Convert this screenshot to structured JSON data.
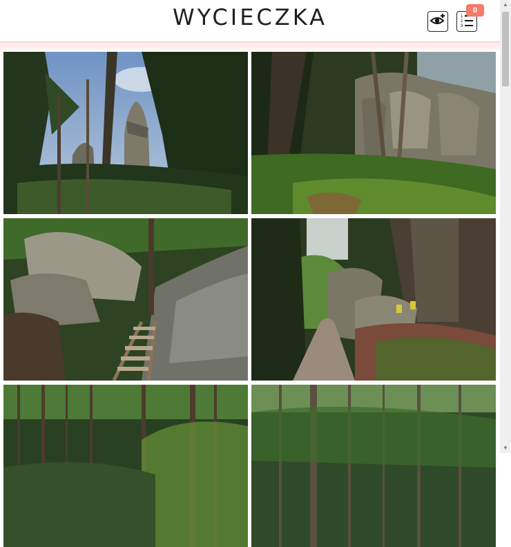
{
  "header": {
    "title": "WYCIECZKA",
    "list_badge_count": "0",
    "icons": {
      "view": "eye-plus-icon",
      "list": "numbered-list-icon"
    }
  },
  "gallery": {
    "photos": [
      {
        "name": "photo-forest-rock-tower"
      },
      {
        "name": "photo-forest-sandstone-wall"
      },
      {
        "name": "photo-rocks-wooden-stairs"
      },
      {
        "name": "photo-forest-path-rocks"
      },
      {
        "name": "photo-dense-spruce-forest-1"
      },
      {
        "name": "photo-dense-spruce-forest-2"
      }
    ]
  },
  "colors": {
    "accent": "#f47c6b",
    "header_border": "#f2c4bc"
  }
}
